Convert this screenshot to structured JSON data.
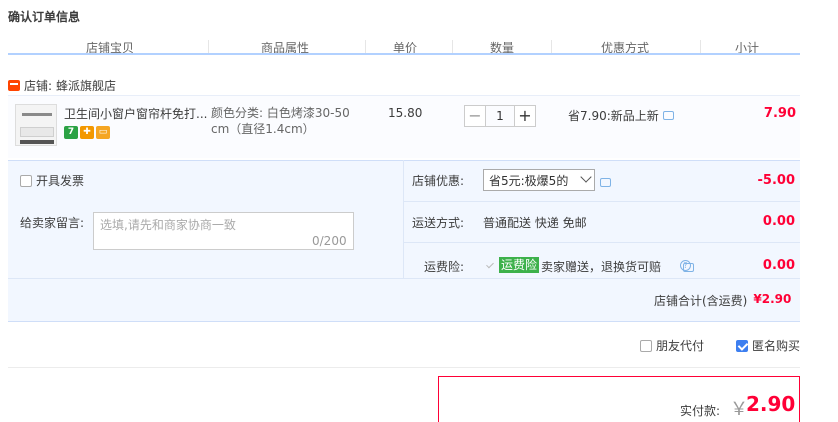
{
  "page_title": "确认订单信息",
  "columns": [
    "店铺宝贝",
    "商品属性",
    "单价",
    "数量",
    "优惠方式",
    "小计"
  ],
  "shop": {
    "label": "店铺:",
    "name": "蜂派旗舰店"
  },
  "item": {
    "title": "卫生间小窗户窗帘杆免打...",
    "attr_line1": "颜色分类: 白色烤漆30-50",
    "attr_line2": "cm（直径1.4cm）",
    "price": "15.80",
    "quantity": "1",
    "qty_minus": "−",
    "qty_plus": "+",
    "promo": "省7.90:新品上新",
    "subtotal": "7.90",
    "service_icons": [
      {
        "icon": "seven-day-return-icon",
        "glyph": "7",
        "color": "#2ba245"
      },
      {
        "icon": "shield-icon",
        "glyph": "✚",
        "color": "#f39800"
      },
      {
        "icon": "credit-card-icon",
        "glyph": "▭",
        "color": "#f5a623"
      }
    ]
  },
  "invoice": {
    "label": "开具发票",
    "checked": false
  },
  "memo": {
    "label": "给卖家留言:",
    "placeholder": "选填,请先和商家协商一致",
    "counter": "0/200"
  },
  "shop_discount": {
    "label": "店铺优惠:",
    "selected": "省5元:极爆5的",
    "value": "-5.00"
  },
  "shipping": {
    "label": "运送方式:",
    "text": "普通配送 快递 免邮",
    "value": "0.00"
  },
  "insurance": {
    "label": "运费险:",
    "tag": "运费险",
    "text": "卖家赠送，退换货可赔",
    "value": "0.00"
  },
  "shop_total": {
    "label": "店铺合计(含运费)",
    "value": "¥2.90"
  },
  "friend_pay": {
    "label": "朋友代付",
    "checked": false
  },
  "anonymous": {
    "label": "匿名购买",
    "checked": true
  },
  "payment": {
    "label": "实付款:",
    "currency": "￥",
    "amount": "2.90"
  },
  "colors": {
    "accent_red": "#ff0036",
    "header_line": "#b2d1ff",
    "panel_bg": "#f2f7ff"
  }
}
